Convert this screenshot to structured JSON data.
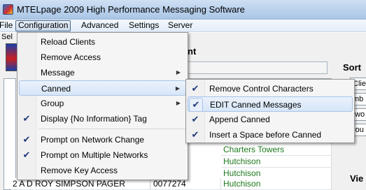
{
  "window": {
    "title": "MTELpage 2009   High Performance Messaging Software"
  },
  "menubar": {
    "items": [
      "File",
      "Configuration",
      "Advanced",
      "Settings",
      "Server"
    ]
  },
  "background": {
    "sel_label": "Sel",
    "panel_heading": "nt",
    "sort_label": "Sort",
    "view_label": "Vie",
    "side_boxes": [
      "Clie",
      "mb",
      "two",
      "rou"
    ]
  },
  "rows": [
    {
      "name": "",
      "code": "",
      "location": "Charters Towers"
    },
    {
      "name": "",
      "code": "",
      "location": "Hutchison"
    },
    {
      "name": "",
      "code": "",
      "location": "Hutchison"
    },
    {
      "name": "2 A D ROY SIMPSON PAGER",
      "code": "0077274",
      "location": "Hutchison"
    }
  ],
  "configuration_menu": {
    "items": [
      {
        "label": "Reload Clients",
        "checked": false,
        "submenu": false
      },
      {
        "label": "Remove Access",
        "checked": false,
        "submenu": false
      },
      {
        "label": "Message",
        "checked": false,
        "submenu": true
      },
      {
        "label": "Canned",
        "checked": false,
        "submenu": true,
        "highlighted": true
      },
      {
        "label": "Group",
        "checked": false,
        "submenu": true
      },
      {
        "label": "Display {No Information} Tag",
        "checked": true,
        "submenu": false
      },
      {
        "label": "Prompt on Network Change",
        "checked": true,
        "submenu": false
      },
      {
        "label": "Prompt on Multiple Networks",
        "checked": true,
        "submenu": false
      },
      {
        "label": "Remove Key Access",
        "checked": false,
        "submenu": false
      }
    ]
  },
  "canned_submenu": {
    "items": [
      {
        "label": "Remove Control  Characters",
        "checked": true
      },
      {
        "label": "EDIT Canned Messages",
        "checked": true,
        "highlighted": true
      },
      {
        "label": "Append Canned",
        "checked": true
      },
      {
        "label": "Insert a Space before Canned",
        "checked": true
      }
    ]
  },
  "icons": {
    "check": "checkmark-icon",
    "submenu": "submenu-arrow-icon",
    "app": "app-icon"
  },
  "colors": {
    "highlight": "#d7e6f8",
    "check": "#1f3a78",
    "location_text": "#1d7a1d"
  }
}
